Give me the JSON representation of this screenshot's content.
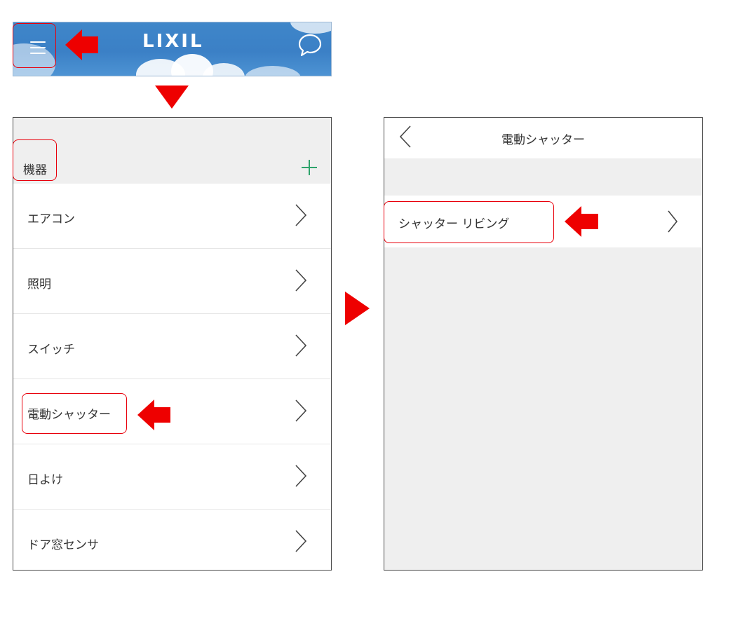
{
  "header": {
    "logo_text": "LIXIL",
    "menu_icon": "hamburger-menu-icon",
    "chat_icon": "speech-bubble-icon",
    "background_color": "#3f86c9"
  },
  "device_list": {
    "section_title": "機器",
    "add_icon": "plus-icon",
    "add_color": "#2ea36b",
    "items": [
      {
        "label": "エアコン"
      },
      {
        "label": "照明"
      },
      {
        "label": "スイッチ"
      },
      {
        "label": "電動シャッター"
      },
      {
        "label": "日よけ"
      },
      {
        "label": "ドア窓センサ"
      }
    ]
  },
  "shutter_screen": {
    "nav_title": "電動シャッター",
    "back_icon": "chevron-left-icon",
    "items": [
      {
        "label": "シャッター リビング"
      }
    ]
  },
  "annotations": {
    "highlight_color": "#e8000b",
    "arrow_color": "#ee0000"
  }
}
